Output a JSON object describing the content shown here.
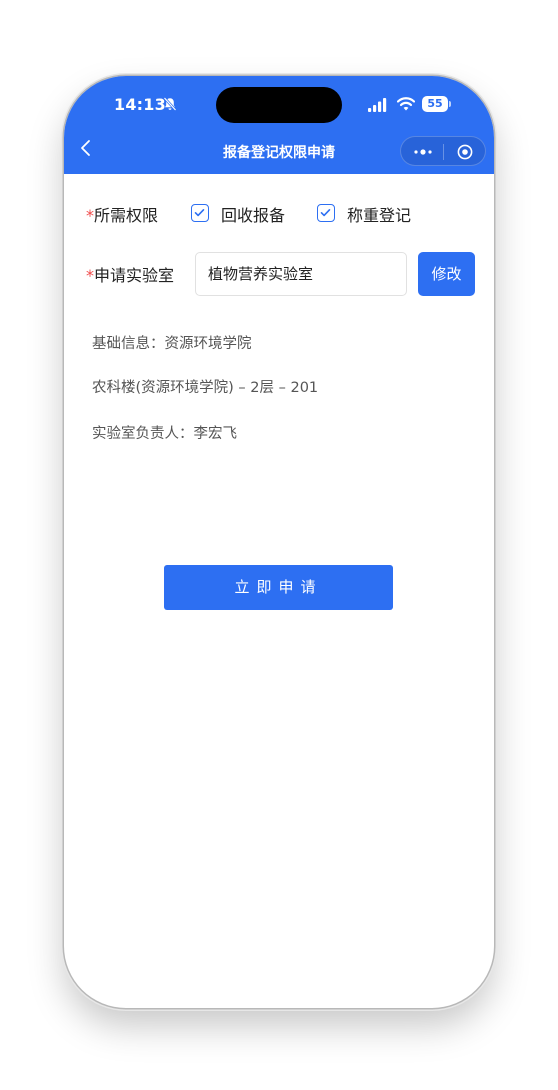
{
  "status_bar": {
    "time": "14:13",
    "battery": "55"
  },
  "nav": {
    "title": "报备登记权限申请"
  },
  "form": {
    "required_mark": "*",
    "permission_label": "所需权限",
    "permissions": [
      {
        "label": "回收报备",
        "checked": true
      },
      {
        "label": "称重登记",
        "checked": true
      }
    ],
    "lab_label": "申请实验室",
    "lab_value": "植物营养实验室",
    "modify_button": "修改"
  },
  "info": {
    "basic": "基础信息：资源环境学院",
    "location": "农科楼(资源环境学院) – 2层 – 201",
    "manager": "实验室负责人：李宏飞"
  },
  "apply_button": "立即申请",
  "colors": {
    "primary": "#2d6ff2",
    "required": "#f04a4a"
  }
}
